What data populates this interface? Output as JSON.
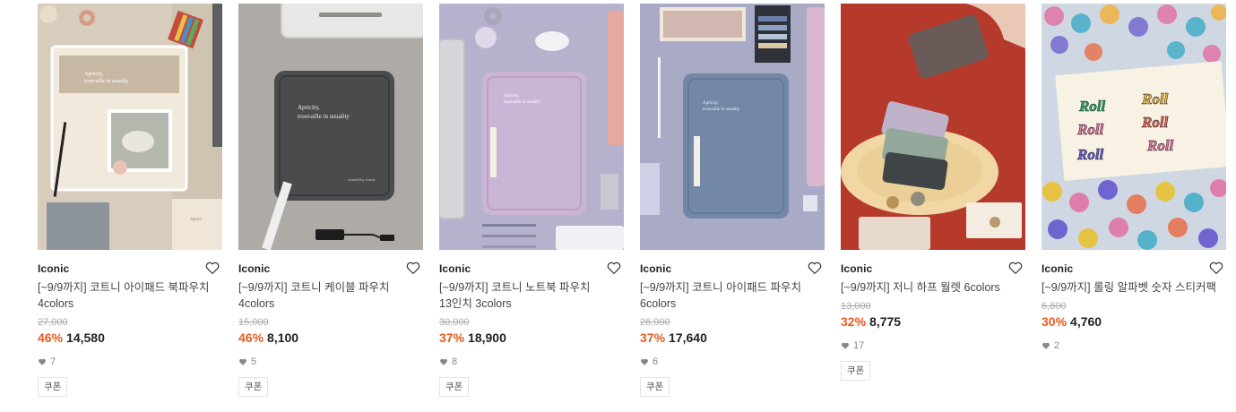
{
  "products": [
    {
      "brand": "Iconic",
      "title": "[~9/9까지] 코트니 아이패드 북파우치 4colors",
      "original_price": "27,000",
      "discount": "46%",
      "price": "14,580",
      "likes": "7",
      "coupon": "쿠폰",
      "image_text": [
        "Apricity,",
        "trouvaille in usuality"
      ]
    },
    {
      "brand": "Iconic",
      "title": "[~9/9까지] 코트니 케이블 파우치 4colors",
      "original_price": "15,000",
      "discount": "46%",
      "price": "8,100",
      "likes": "5",
      "coupon": "쿠폰",
      "image_text": [
        "Apricity,",
        "trouvaille in usuality",
        "created by iconic"
      ]
    },
    {
      "brand": "Iconic",
      "title": "[~9/9까지] 코트니 노트북 파우치 13인치 3colors",
      "original_price": "30,000",
      "discount": "37%",
      "price": "18,900",
      "likes": "8",
      "coupon": "쿠폰",
      "image_text": [
        "Apricity,",
        "trouvaille in usuality"
      ]
    },
    {
      "brand": "Iconic",
      "title": "[~9/9까지] 코트니 아이패드 파우치 6colors",
      "original_price": "28,000",
      "discount": "37%",
      "price": "17,640",
      "likes": "6",
      "coupon": "쿠폰",
      "image_text": [
        "Apricity,",
        "trouvaille in usuality"
      ]
    },
    {
      "brand": "Iconic",
      "title": "[~9/9까지] 저니 하프 월렛 6colors",
      "original_price": "13,000",
      "discount": "32%",
      "price": "8,775",
      "likes": "17",
      "coupon": "쿠폰"
    },
    {
      "brand": "Iconic",
      "title": "[~9/9까지] 롤링 알파벳 숫자 스티커팩",
      "original_price": "6,800",
      "discount": "30%",
      "price": "4,760",
      "likes": "2",
      "image_text": [
        "Roll",
        "Roll",
        "Roll",
        "Roll",
        "Roll",
        "Roll"
      ]
    }
  ],
  "colors": {
    "discount": "#e85a1e",
    "text": "#222222",
    "muted": "#aaaaaa"
  },
  "icons": {
    "wishlist": "heart-outline-icon",
    "likes": "heart-filled-icon"
  }
}
